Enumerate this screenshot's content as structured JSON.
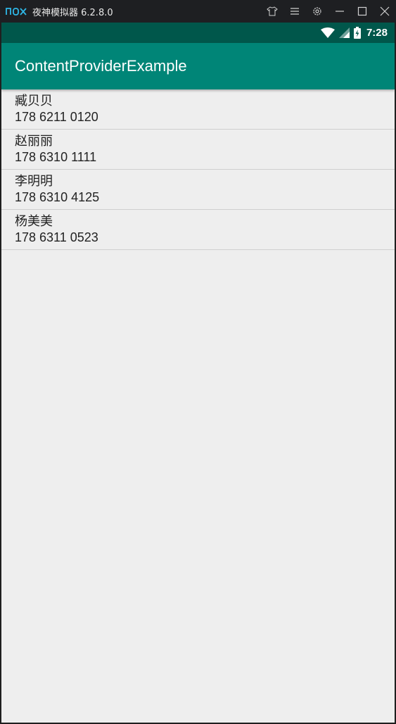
{
  "window": {
    "title": "夜神模拟器 6.2.8.0",
    "logo_text": "nox",
    "icons": [
      "shirt-icon",
      "menu-icon",
      "gear-icon",
      "minimize-icon",
      "maximize-icon",
      "close-icon"
    ]
  },
  "status_bar": {
    "time": "7:28",
    "icons": [
      "wifi-icon",
      "signal-icon",
      "battery-charging-icon"
    ]
  },
  "app": {
    "title": "ContentProviderExample"
  },
  "contacts": [
    {
      "name": "臧贝贝",
      "phone": "178 6211 0120"
    },
    {
      "name": "赵丽丽",
      "phone": "178 6310 1111"
    },
    {
      "name": "李明明",
      "phone": "178 6310 4125"
    },
    {
      "name": "杨美美",
      "phone": "178 6311 0523"
    }
  ],
  "colors": {
    "app_bar": "#008577",
    "status_bar": "#00574b",
    "background": "#eeeeee",
    "window_chrome": "#1e1f22",
    "nox_logo": "#2fb8e8"
  }
}
